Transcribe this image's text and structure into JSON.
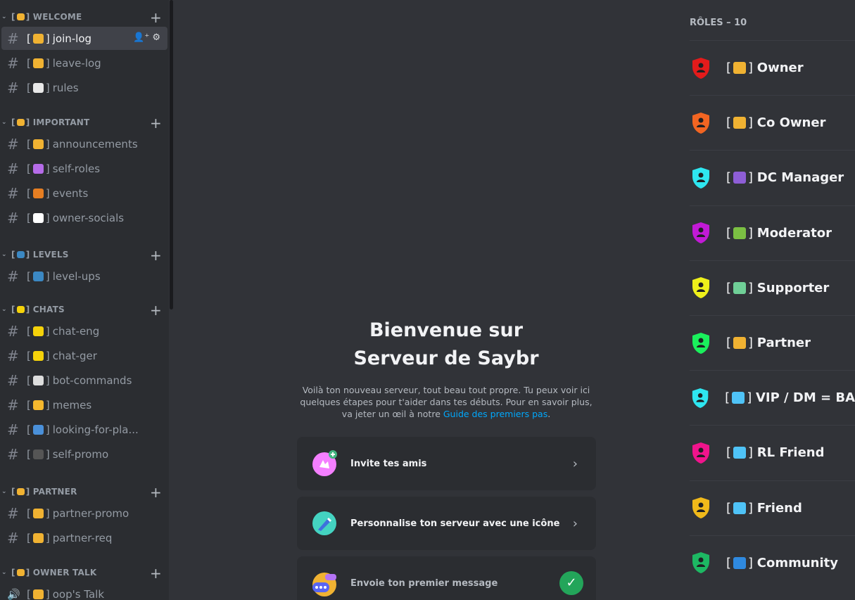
{
  "sidebar": {
    "categories": [
      {
        "name": "WELCOME",
        "emoji_color": "#f0b232",
        "channels": [
          {
            "name": "join-log",
            "emoji_color": "#f0b232",
            "active": true
          },
          {
            "name": "leave-log",
            "emoji_color": "#f0b232"
          },
          {
            "name": "rules",
            "emoji_color": "#e8e8e8"
          }
        ]
      },
      {
        "name": "IMPORTANT",
        "emoji_color": "#f0b232",
        "channels": [
          {
            "name": "announcements",
            "emoji_color": "#f0b232"
          },
          {
            "name": "self-roles",
            "emoji_color": "#b56be8"
          },
          {
            "name": "events",
            "emoji_color": "#e67e22"
          },
          {
            "name": "owner-socials",
            "emoji_color": "#ffffff"
          }
        ]
      },
      {
        "name": "LEVELS",
        "emoji_color": "#3b88c3",
        "channels": [
          {
            "name": "level-ups",
            "emoji_color": "#3b88c3"
          }
        ]
      },
      {
        "name": "CHATS",
        "emoji_color": "#f5d20a",
        "channels": [
          {
            "name": "chat-eng",
            "emoji_color": "#f5d20a"
          },
          {
            "name": "chat-ger",
            "emoji_color": "#f5d20a"
          },
          {
            "name": "bot-commands",
            "emoji_color": "#dddddd"
          },
          {
            "name": "memes",
            "emoji_color": "#f5b82e"
          },
          {
            "name": "looking-for-pla...",
            "emoji_color": "#4a90d9"
          },
          {
            "name": "self-promo",
            "emoji_color": "#555555"
          }
        ]
      },
      {
        "name": "PARTNER",
        "emoji_color": "#f0b232",
        "channels": [
          {
            "name": "partner-promo",
            "emoji_color": "#f0b232"
          },
          {
            "name": "partner-req",
            "emoji_color": "#f0b232"
          }
        ]
      },
      {
        "name": "OWNER TALK",
        "emoji_color": "#f0b232",
        "channels": [
          {
            "name": "oop's Talk",
            "emoji_color": "#f0b232",
            "voice": true
          }
        ]
      }
    ]
  },
  "welcome": {
    "title_line1": "Bienvenue sur",
    "title_line2": "Serveur de Saybr",
    "desc": "Voilà ton nouveau serveur, tout beau tout propre. Tu peux voir ici quelques étapes pour t'aider dans tes débuts. Pour en savoir plus, va jeter un œil à notre ",
    "link": "Guide des premiers pas",
    "desc_end": ".",
    "cards": [
      {
        "label": "Invite tes amis",
        "icon": "invite-icon",
        "done": false
      },
      {
        "label": "Personnalise ton serveur avec une icône",
        "icon": "paint-icon",
        "done": false
      },
      {
        "label": "Envoie ton premier message",
        "icon": "message-icon",
        "done": true
      }
    ]
  },
  "roles": {
    "heading": "RÔLES – 10",
    "items": [
      {
        "name": "Owner",
        "color": "#e31b1b",
        "emoji_color": "#f0b232"
      },
      {
        "name": "Co Owner",
        "color": "#f26522",
        "emoji_color": "#f0b232"
      },
      {
        "name": "DC Manager",
        "color": "#2ee6f0",
        "emoji_color": "#8e5ed6"
      },
      {
        "name": "Moderator",
        "color": "#c21ad6",
        "emoji_color": "#7bc043"
      },
      {
        "name": "Supporter",
        "color": "#eef01a",
        "emoji_color": "#6fcf97"
      },
      {
        "name": "Partner",
        "color": "#1af05c",
        "emoji_color": "#f0b232"
      },
      {
        "name": "VIP / DM = BA",
        "color": "#2ee6f0",
        "emoji_color": "#4fc3f7"
      },
      {
        "name": "RL Friend",
        "color": "#f0148c",
        "emoji_color": "#4fc3f7"
      },
      {
        "name": "Friend",
        "color": "#f0b91a",
        "emoji_color": "#4fc3f7"
      },
      {
        "name": "Community",
        "color": "#1db863",
        "emoji_color": "#2f8ae0"
      }
    ]
  }
}
